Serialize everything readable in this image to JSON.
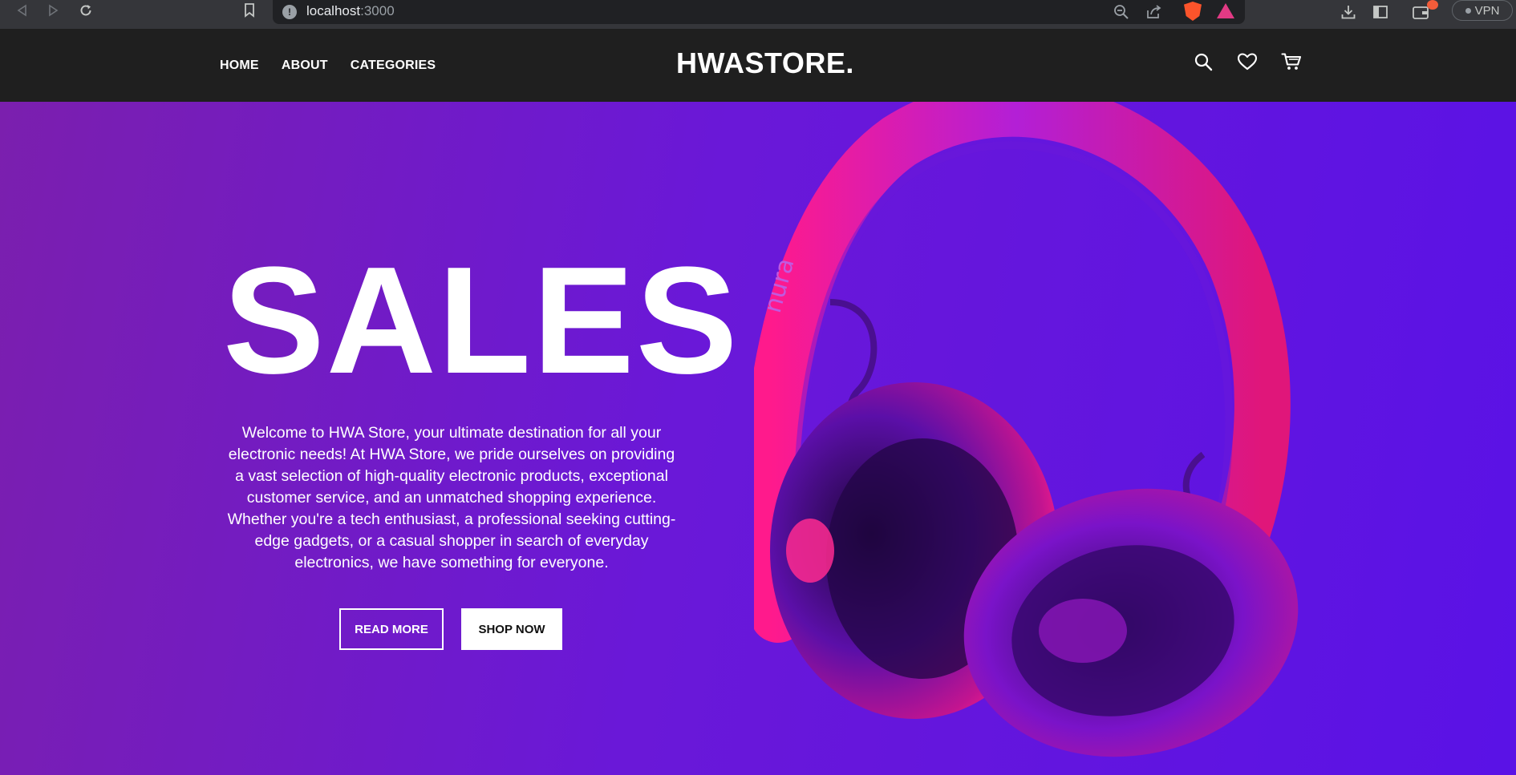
{
  "browser": {
    "url_host": "localhost",
    "url_port": ":3000",
    "vpn_label": "VPN"
  },
  "header": {
    "nav": [
      "HOME",
      "ABOUT",
      "CATEGORIES"
    ],
    "logo": "HWASTORE.",
    "icons": [
      "search-icon",
      "heart-icon",
      "cart-icon"
    ]
  },
  "hero": {
    "title": "SALES",
    "description": "Welcome to HWA Store, your ultimate destination for all your electronic needs! At HWA Store, we pride ourselves on providing a vast selection of high-quality electronic products, exceptional customer service, and an unmatched shopping experience. Whether you're a tech enthusiast, a professional seeking cutting-edge gadgets, or a casual shopper in search of everyday electronics, we have something for everyone.",
    "read_more": "READ MORE",
    "shop_now": "SHOP NOW",
    "product_brand": "nura"
  },
  "colors": {
    "header_bg": "#1f1f1f",
    "hero_start": "#7b1fae",
    "hero_end": "#5a12e6",
    "headphone_pink": "#ff1a8c"
  }
}
